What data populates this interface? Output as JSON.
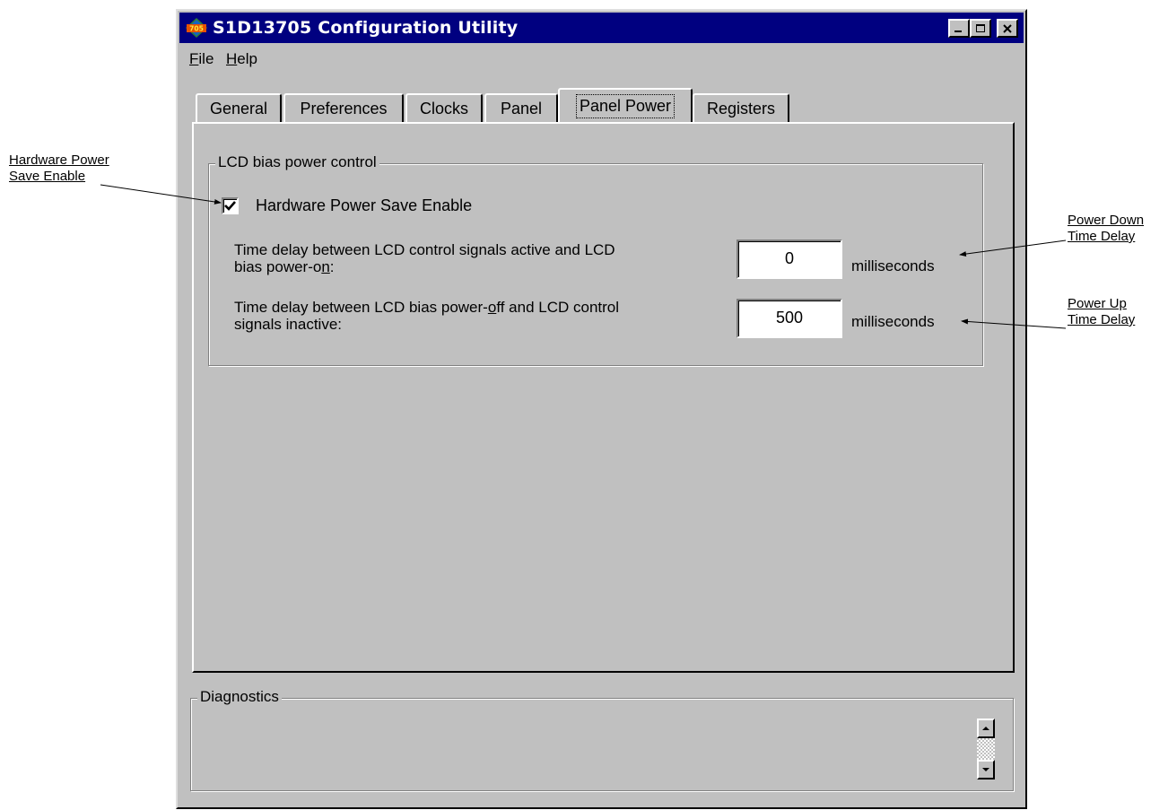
{
  "window": {
    "title": "S1D13705 Configuration Utility",
    "icon_text": "705"
  },
  "menu": [
    {
      "label_rest": "ile",
      "accel": "F"
    },
    {
      "label_rest": "elp",
      "accel": "H"
    }
  ],
  "tabs": [
    "General",
    "Preferences",
    "Clocks",
    "Panel",
    "Panel Power",
    "Registers"
  ],
  "active_tab": "Panel Power",
  "lcd_group": {
    "title": "LCD bias power control",
    "hw_checkbox": {
      "label": "Hardware Power Save Enable",
      "checked": true
    },
    "power_on_delay": {
      "line1": "Time delay between LCD control signals active and LCD",
      "line2_pre": "bias power-o",
      "line2_accel": "n",
      "line2_post": ":",
      "value": "0",
      "unit": "milliseconds"
    },
    "power_off_delay": {
      "line1_pre": "Time delay between LCD bias power-",
      "line1_accel": "o",
      "line1_post": "ff and LCD control",
      "line2": "signals inactive:",
      "value": "500",
      "unit": "milliseconds"
    }
  },
  "diagnostics": {
    "title": "Diagnostics"
  },
  "callouts": {
    "hw_power_save": {
      "line1": "Hardware Power",
      "line2": "Save Enable"
    },
    "power_down": {
      "line1": "Power Down",
      "line2": "Time Delay"
    },
    "power_up": {
      "line1": "Power Up",
      "line2": "Time Delay"
    }
  },
  "colors": {
    "titlebar": "#000080",
    "face": "#c0c0c0"
  }
}
